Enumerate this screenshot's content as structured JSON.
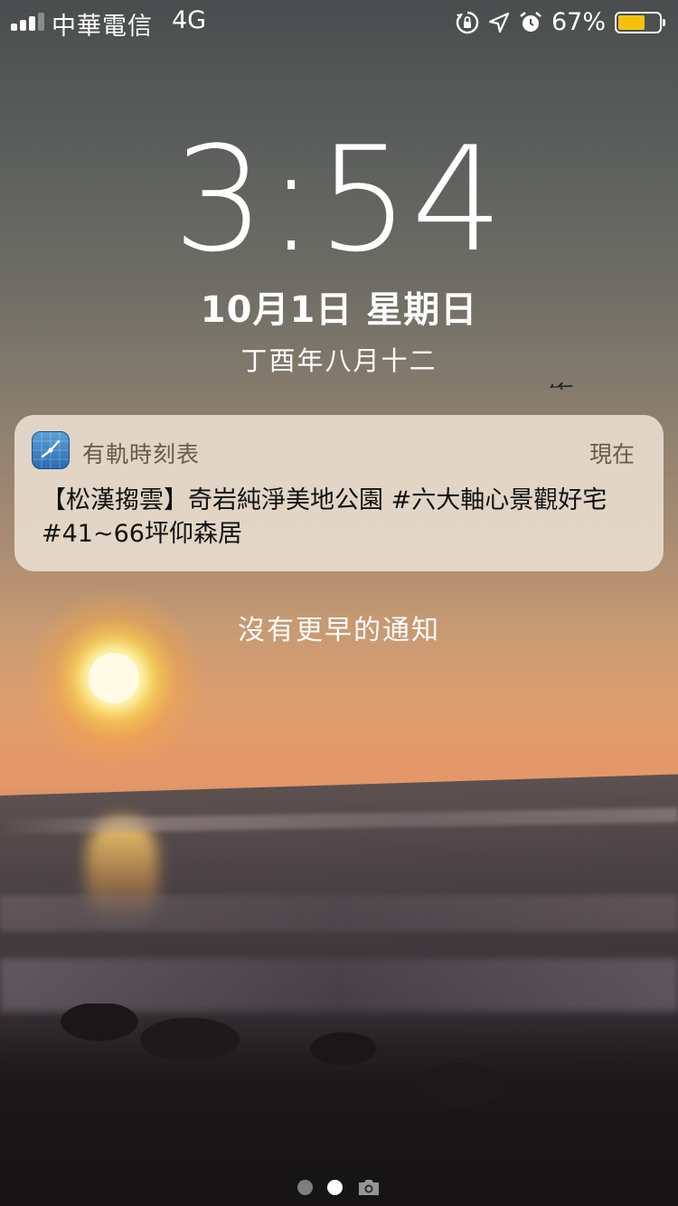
{
  "status_bar": {
    "carrier": "中華電信",
    "network": "4G",
    "battery_percent": "67%",
    "battery_level": 0.67,
    "signal_bars": 3,
    "signal_bars_total": 4,
    "icons": [
      "orientation-lock-icon",
      "location-arrow-icon",
      "alarm-clock-icon",
      "battery-icon"
    ]
  },
  "lock_screen": {
    "time": "3:54",
    "date": "10月1日 星期日",
    "lunar_date": "丁酉年八月十二"
  },
  "notification": {
    "app_name": "有軌時刻表",
    "time": "現在",
    "body": "【松漢搊雲】奇岩純淨美地公園 #六大軸心景觀好宅 #41~66坪仰森居",
    "app_icon": "clock-app-icon"
  },
  "no_older_notifications": "沒有更早的通知",
  "page_indicator": {
    "pages": 2,
    "active_index": 1,
    "extra_icon": "camera-icon"
  },
  "colors": {
    "battery_fill": "#f4c20d",
    "notification_bg": "#eee2d4",
    "notification_meta_text": "#6b5a45"
  }
}
